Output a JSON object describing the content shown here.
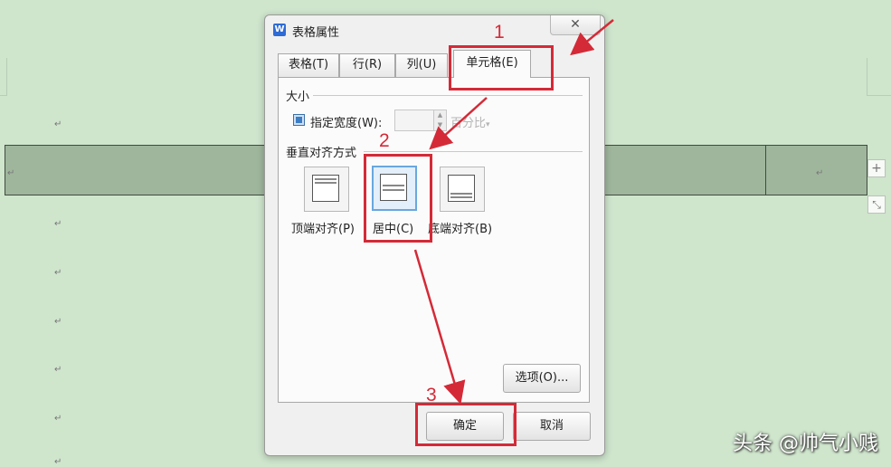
{
  "dialog": {
    "title": "表格属性",
    "app_icon": "W",
    "close_glyph": "✕",
    "tabs": [
      {
        "label": "表格(T)"
      },
      {
        "label": "行(R)"
      },
      {
        "label": "列(U)"
      },
      {
        "label": "单元格(E)"
      }
    ],
    "active_tab": "单元格(E)",
    "size_section": {
      "label": "大小",
      "width_checkbox_label": "指定宽度(W):",
      "width_checked": true,
      "width_value": "",
      "unit": "百分比",
      "unit_arrow": "▾"
    },
    "valign_section": {
      "label": "垂直对齐方式",
      "options": [
        {
          "label": "顶端对齐(P)",
          "icon": "align-top-icon"
        },
        {
          "label": "居中(C)",
          "icon": "align-middle-icon"
        },
        {
          "label": "底端对齐(B)",
          "icon": "align-bottom-icon"
        }
      ],
      "selected": "居中(C)"
    },
    "options_button": "选项(O)...",
    "ok_button": "确定",
    "cancel_button": "取消"
  },
  "document": {
    "paragraph_mark": "↵",
    "add_row_glyph": "+",
    "resize_glyph": "⤡"
  },
  "annotations": {
    "step_numbers": [
      "1",
      "2",
      "3"
    ],
    "color": "#d42a37"
  },
  "watermark": "头条 @帅气小贱",
  "colors": {
    "background": "#cfe5cc",
    "table_row": "#9fb69d",
    "selection_blue": "#69a7df",
    "annotation_red": "#d42a37"
  }
}
